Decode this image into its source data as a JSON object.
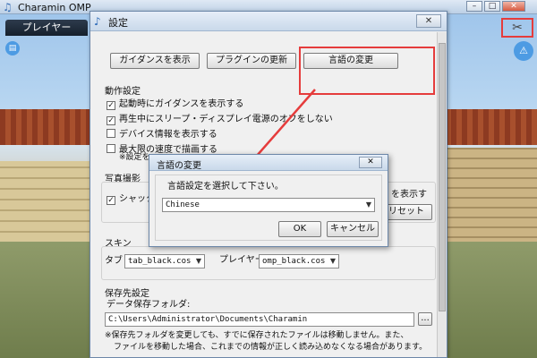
{
  "app": {
    "title": "Charamin OMP",
    "player_tab": "プレイヤー"
  },
  "window_controls": {
    "minimize": "–",
    "maximize": "□",
    "close": "✕"
  },
  "settings": {
    "title": "設定",
    "close": "✕",
    "top_buttons": {
      "guidance": "ガイダンスを表示",
      "plugin": "プラグインの更新",
      "language": "言語の変更"
    },
    "behavior": {
      "heading": "動作設定",
      "items": [
        {
          "label": "起動時にガイダンスを表示する",
          "checked": "✓"
        },
        {
          "label": "再生中にスリープ・ディスプレイ電源のオフをしない",
          "checked": "✓"
        },
        {
          "label": "デバイス情報を表示する",
          "checked": ""
        },
        {
          "label": "最大限の速度で描画する",
          "checked": ""
        }
      ],
      "note": "※設定を"
    },
    "photo": {
      "heading": "写真撮影",
      "shutter_label": "シャッタ",
      "shutter_checked": "✓",
      "show_text": "を表示す",
      "reset_button": "リセット"
    },
    "skin": {
      "heading": "スキン",
      "tab_label": "タブ",
      "tab_value": "tab_black.cos",
      "player_label": "プレイヤー",
      "player_value": "omp_black.cos"
    },
    "save": {
      "heading": "保存先設定",
      "folder_label": "データ保存フォルダ:",
      "path": "C:\\Users\\Administrator\\Documents\\Charamin",
      "browse": "...",
      "note_line1": "※保存先フォルダを変更しても、すでに保存されたファイルは移動しません。また、",
      "note_line2": "ファイルを移動した場合、これまでの情報が正しく読み込めなくなる場合があります。"
    }
  },
  "language_dialog": {
    "title": "言語の変更",
    "close": "✕",
    "prompt": "言語設定を選択して下さい。",
    "selected": "Chinese",
    "ok": "OK",
    "cancel": "キャンセル"
  },
  "icons": {
    "tools": "tools-icon",
    "warning": "warning-icon",
    "document": "document-icon",
    "app": "app-icon"
  },
  "colors": {
    "highlight": "#e53c3c",
    "title_blue": "#c9d9ea",
    "player_tab": "#16202c"
  }
}
